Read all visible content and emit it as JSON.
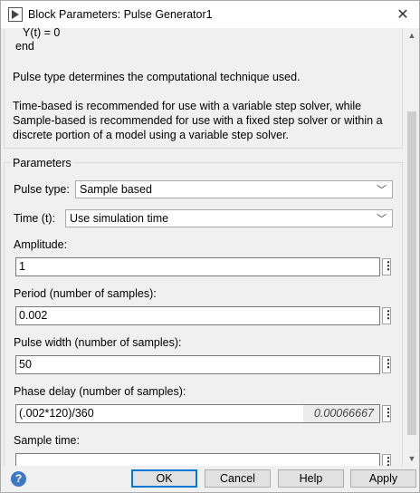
{
  "window": {
    "title": "Block Parameters: Pulse Generator1"
  },
  "description": {
    "code_line1": "Y(t) = 0",
    "code_line2": "end",
    "para1": "Pulse type determines the computational technique used.",
    "para2": "Time-based is recommended for use with a variable step solver, while Sample-based is recommended for use with a fixed step solver or within a discrete portion of a model using a variable step solver."
  },
  "parameters": {
    "group_title": "Parameters",
    "pulse_type": {
      "label": "Pulse type:",
      "value": "Sample based"
    },
    "time": {
      "label": "Time (t):",
      "value": "Use simulation time"
    },
    "amplitude": {
      "label": "Amplitude:",
      "value": "1"
    },
    "period": {
      "label": "Period (number of samples):",
      "value": "0.002"
    },
    "pulse_width": {
      "label": "Pulse width (number of samples):",
      "value": "50"
    },
    "phase_delay": {
      "label": "Phase delay (number of samples):",
      "value": "(.002*120)/360",
      "evaluated": "0.00066667"
    },
    "sample_time": {
      "label": "Sample time:"
    }
  },
  "icons": {
    "field_menu": "⋮",
    "chevron": "﹀"
  },
  "buttons": {
    "ok": "OK",
    "cancel": "Cancel",
    "help": "Help",
    "apply": "Apply"
  }
}
